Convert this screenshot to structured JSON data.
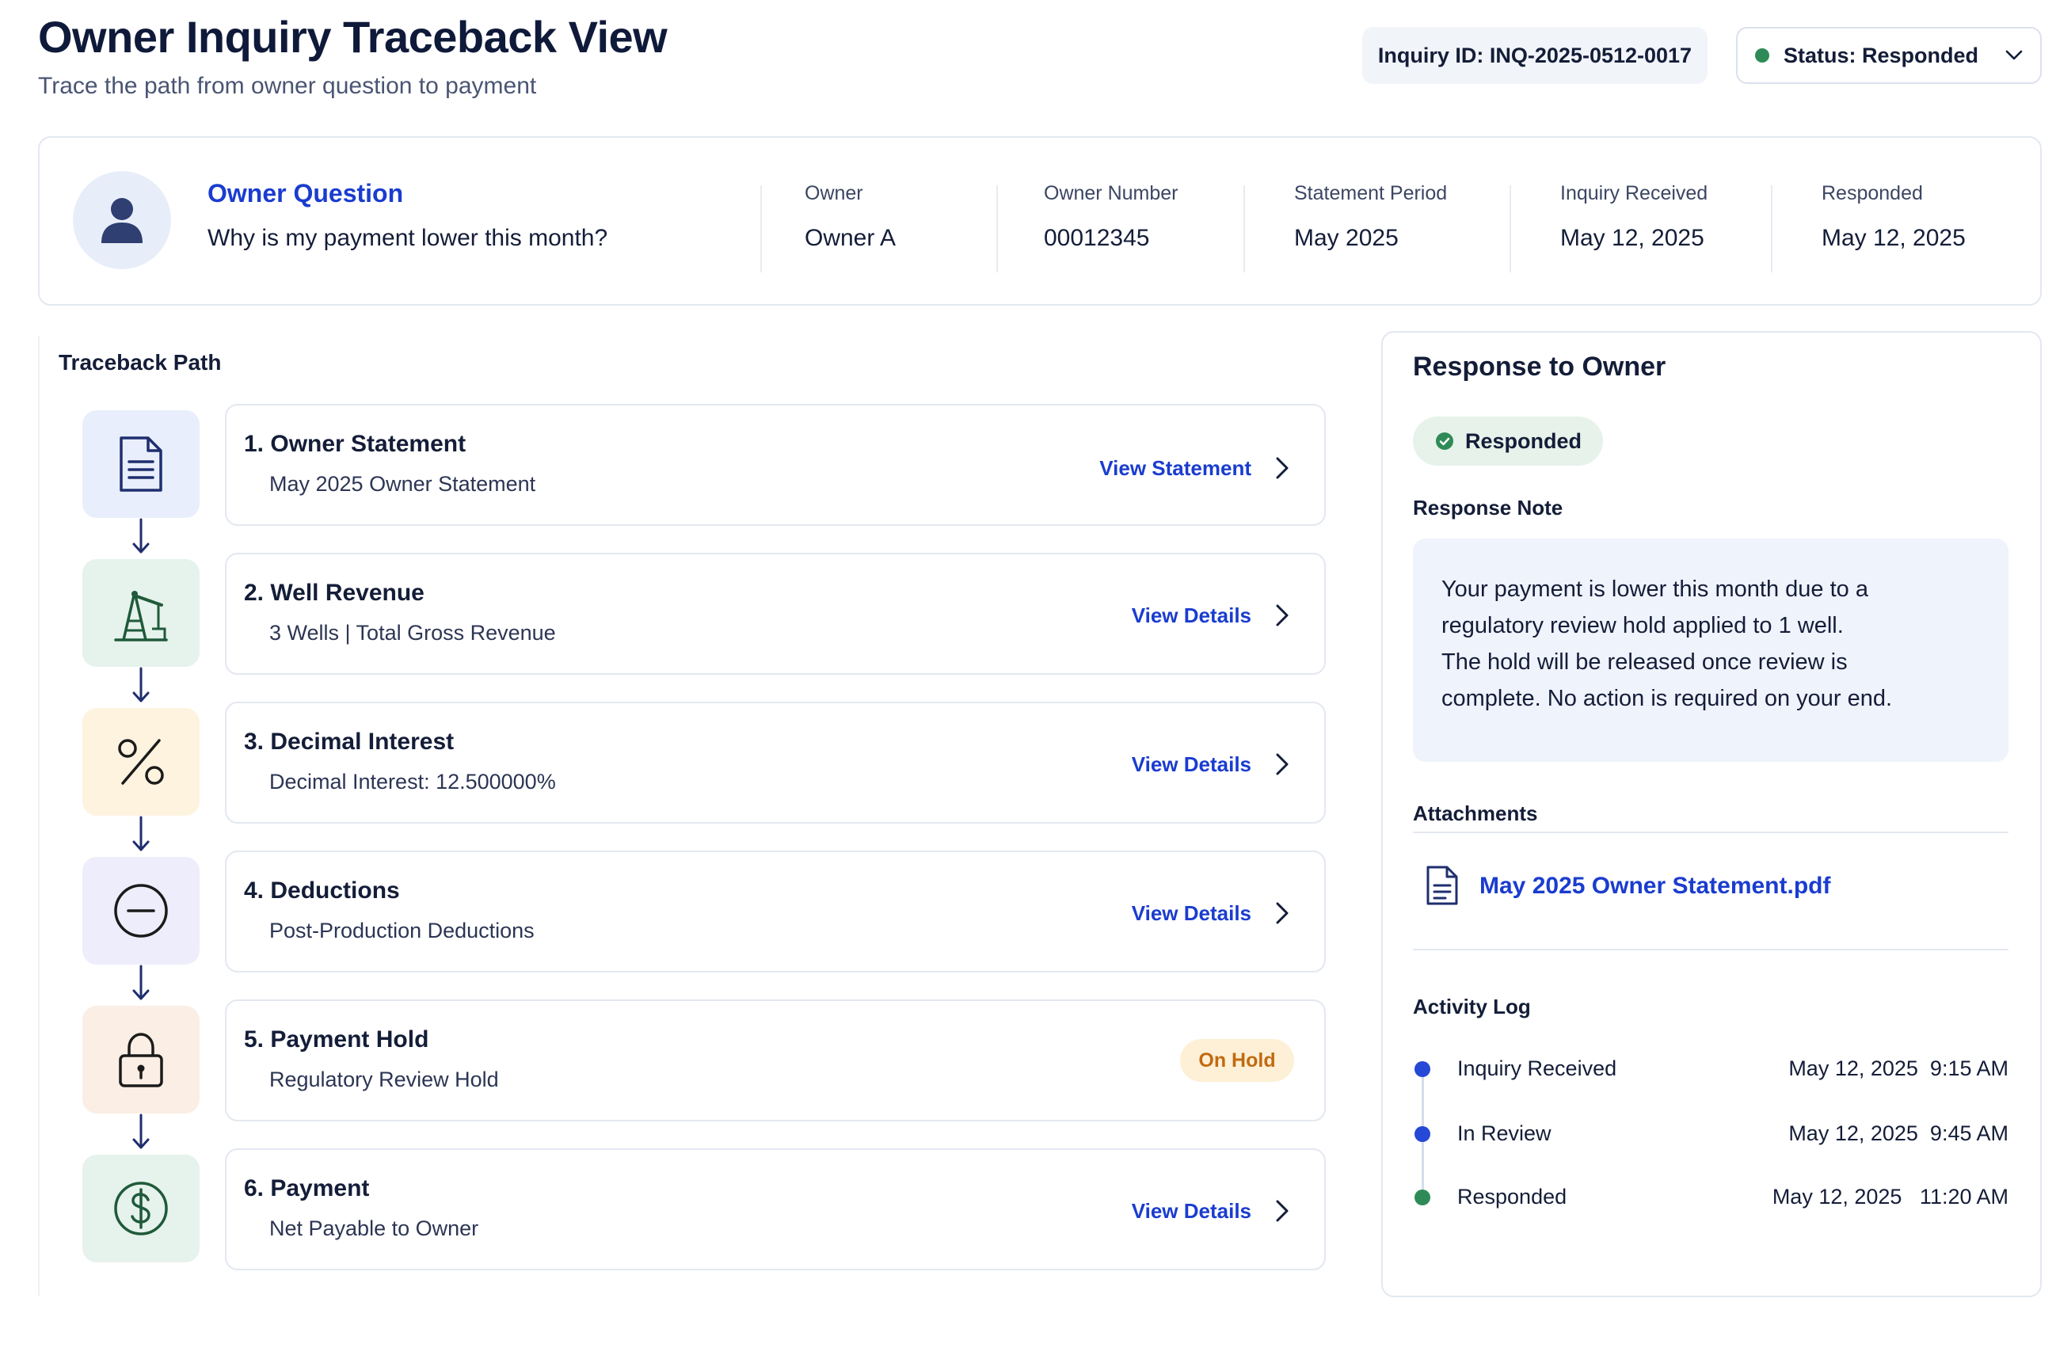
{
  "header": {
    "title": "Owner Inquiry Traceback View",
    "subtitle": "Trace the path from owner question to payment",
    "inquiry_id": "Inquiry ID: INQ-2025-0512-0017",
    "status_label": "Status: Responded"
  },
  "summary": {
    "question_label": "Owner Question",
    "question_text": "Why is my payment lower this month?",
    "fields": [
      {
        "label": "Owner",
        "value": "Owner A"
      },
      {
        "label": "Owner Number",
        "value": "00012345"
      },
      {
        "label": "Statement Period",
        "value": "May 2025"
      },
      {
        "label": "Inquiry Received",
        "value": "May 12, 2025"
      },
      {
        "label": "Responded",
        "value": "May 12, 2025"
      }
    ]
  },
  "traceback": {
    "label": "Traceback Path",
    "steps": [
      {
        "title": "1. Owner Statement",
        "subtitle": "May 2025 Owner Statement",
        "action": "View Statement",
        "icon": "document-icon"
      },
      {
        "title": "2. Well Revenue",
        "subtitle": "3 Wells | Total Gross Revenue",
        "action": "View Details",
        "icon": "oil-pump-icon"
      },
      {
        "title": "3. Decimal Interest",
        "subtitle": "Decimal Interest: 12.500000%",
        "action": "View Details",
        "icon": "percent-icon"
      },
      {
        "title": "4. Deductions",
        "subtitle": "Post-Production Deductions",
        "action": "View Details",
        "icon": "minus-circle-icon"
      },
      {
        "title": "5. Payment Hold",
        "subtitle": "Regulatory Review Hold",
        "badge": "On Hold",
        "icon": "lock-icon"
      },
      {
        "title": "6. Payment",
        "subtitle": "Net Payable to Owner",
        "action": "View Details",
        "icon": "dollar-icon"
      }
    ]
  },
  "response": {
    "title": "Response to Owner",
    "status_badge": "Responded",
    "note_label": "Response Note",
    "note_lines": [
      "Your payment is lower this month due to a",
      "regulatory review hold applied to 1 well.",
      "The hold will be released once review is",
      "complete. No action is required on your end."
    ],
    "attachments_label": "Attachments",
    "attachment": "May 2025 Owner Statement.pdf",
    "activity_label": "Activity Log",
    "activity": [
      {
        "label": "Inquiry Received",
        "time": "May 12, 2025  9:15 AM"
      },
      {
        "label": "In Review",
        "time": "May 12, 2025  9:45 AM"
      },
      {
        "label": "Responded",
        "time": "May 12, 2025   11:20 AM"
      }
    ]
  },
  "colors": {
    "accent_blue": "#1a3ccf",
    "success_green": "#2e8b57",
    "hold_orange": "#c26a10",
    "log_blue": "#2548d6"
  }
}
